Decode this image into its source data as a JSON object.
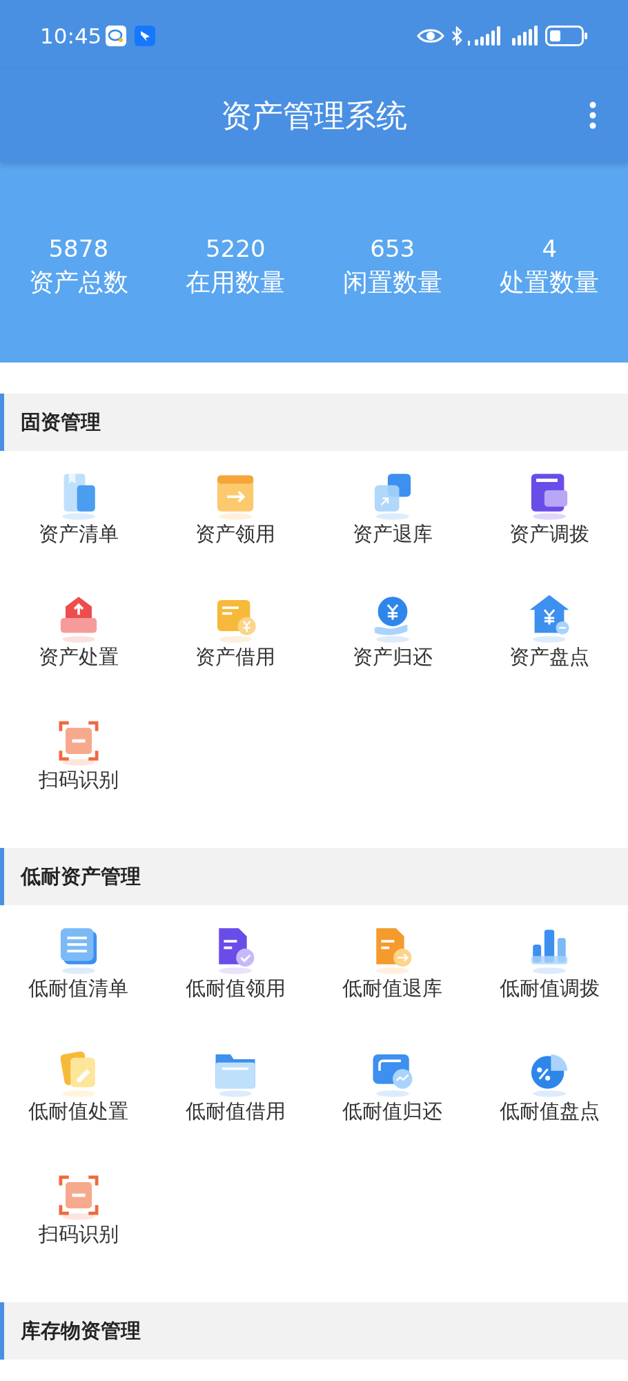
{
  "status_bar": {
    "time": "10:45"
  },
  "header": {
    "title": "资产管理系统"
  },
  "stats": [
    {
      "value": "5878",
      "label": "资产总数"
    },
    {
      "value": "5220",
      "label": "在用数量"
    },
    {
      "value": "653",
      "label": "闲置数量"
    },
    {
      "value": "4",
      "label": "处置数量"
    }
  ],
  "sections": [
    {
      "title": "固资管理",
      "items": [
        {
          "label": "资产清单",
          "kind": "book"
        },
        {
          "label": "资产领用",
          "kind": "clapper"
        },
        {
          "label": "资产退库",
          "kind": "squares"
        },
        {
          "label": "资产调拨",
          "kind": "card"
        },
        {
          "label": "资产处置",
          "kind": "tray"
        },
        {
          "label": "资产借用",
          "kind": "cardyen"
        },
        {
          "label": "资产归还",
          "kind": "coinhand"
        },
        {
          "label": "资产盘点",
          "kind": "house"
        },
        {
          "label": "扫码识别",
          "kind": "scan"
        }
      ]
    },
    {
      "title": "低耐资产管理",
      "items": [
        {
          "label": "低耐值清单",
          "kind": "list"
        },
        {
          "label": "低耐值领用",
          "kind": "filecheck"
        },
        {
          "label": "低耐值退库",
          "kind": "filearrow"
        },
        {
          "label": "低耐值调拨",
          "kind": "bars"
        },
        {
          "label": "低耐值处置",
          "kind": "note"
        },
        {
          "label": "低耐值借用",
          "kind": "folder"
        },
        {
          "label": "低耐值归还",
          "kind": "cardchart"
        },
        {
          "label": "低耐值盘点",
          "kind": "pie"
        },
        {
          "label": "扫码识别",
          "kind": "scan"
        }
      ]
    },
    {
      "title": "库存物资管理"
    }
  ]
}
